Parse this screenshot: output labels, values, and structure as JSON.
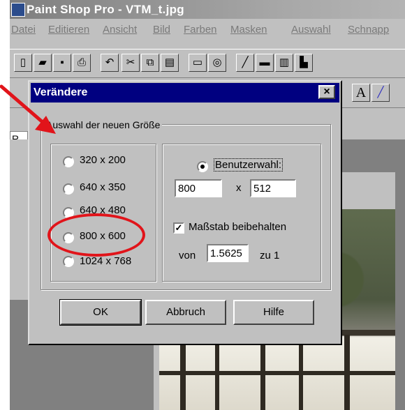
{
  "app": {
    "title": "Paint Shop Pro - VTM_t.jpg",
    "menu": [
      "Datei",
      "Editieren",
      "Ansicht",
      "Bild",
      "Farben",
      "Masken",
      "Auswahl",
      "Schnapp"
    ]
  },
  "toolbar2": {
    "text_tool_label": "A",
    "ruler_label": "R"
  },
  "dialog": {
    "title": "Verändere",
    "close_label": "×",
    "group_label": "Auswahl der neuen Größe",
    "sizes": [
      "320 x 200",
      "640 x 350",
      "640 x 480",
      "800 x 600",
      "1024 x 768"
    ],
    "custom": {
      "label": "Benutzerwahl:",
      "width": "800",
      "x_separator": "x",
      "height": "512",
      "keep_ratio_label": "Maßstab beibehalten",
      "keep_ratio_checked": true,
      "from_label": "von",
      "ratio_value": "1.5625",
      "to_label": "zu 1"
    },
    "buttons": {
      "ok": "OK",
      "cancel": "Abbruch",
      "help": "Hilfe"
    }
  },
  "colors": {
    "annotation": "#e1141a",
    "dialog_title_bg": "#000080"
  }
}
